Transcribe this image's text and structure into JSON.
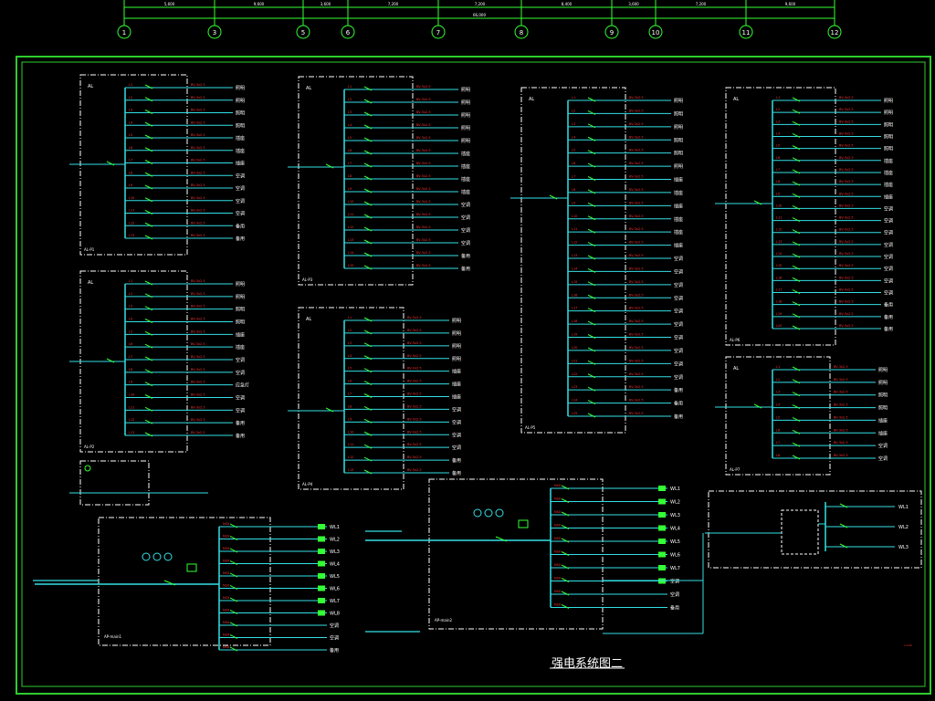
{
  "drawing": {
    "title": "强电系统图二",
    "grid_axes": [
      "1",
      "3",
      "5",
      "6",
      "7",
      "8",
      "9",
      "10",
      "11",
      "12"
    ],
    "dimension_values": [
      "5,600",
      "9,600",
      "3,600",
      "7,200",
      "7,200",
      "8,400",
      "3,600",
      "7,200",
      "9,600"
    ],
    "total_dimension": "66,000"
  },
  "panels": {
    "p1": {
      "feeder_labels": [
        "照明",
        "照明",
        "照明",
        "照明",
        "插座",
        "插座",
        "插座",
        "空调",
        "空调",
        "空调",
        "空调",
        "备用",
        "备用"
      ]
    },
    "p2": {
      "feeder_labels": [
        "照明",
        "照明",
        "照明",
        "照明",
        "插座",
        "插座",
        "空调",
        "空调",
        "应急灯",
        "空调",
        "空调",
        "备用",
        "备用"
      ]
    },
    "p3": {
      "feeder_labels": [
        "照明",
        "照明",
        "照明",
        "照明",
        "照明",
        "插座",
        "插座",
        "插座",
        "插座",
        "空调",
        "空调",
        "空调",
        "空调",
        "备用",
        "备用"
      ]
    },
    "p4": {
      "feeder_labels": [
        "照明",
        "照明",
        "照明",
        "照明",
        "插座",
        "插座",
        "插座",
        "空调",
        "空调",
        "空调",
        "空调",
        "备用",
        "备用"
      ]
    },
    "p5": {
      "feeder_labels": [
        "照明",
        "照明",
        "照明",
        "照明",
        "照明",
        "照明",
        "插座",
        "插座",
        "插座",
        "插座",
        "插座",
        "插座",
        "空调",
        "空调",
        "空调",
        "空调",
        "空调",
        "空调",
        "空调",
        "空调",
        "空调",
        "空调",
        "备用",
        "备用",
        "备用"
      ]
    },
    "p6": {
      "feeder_labels": [
        "照明",
        "照明",
        "照明",
        "照明",
        "照明",
        "插座",
        "插座",
        "插座",
        "插座",
        "空调",
        "空调",
        "空调",
        "空调",
        "空调",
        "空调",
        "空调",
        "空调",
        "备用",
        "备用",
        "备用"
      ]
    },
    "p7": {
      "feeder_labels": [
        "照明",
        "照明",
        "照明",
        "照明",
        "插座",
        "插座",
        "空调",
        "空调"
      ]
    },
    "main1": {
      "feeder_labels": [
        "WL1",
        "WL2",
        "WL3",
        "WL4",
        "WL5",
        "WL6",
        "WL7",
        "WL8",
        "空调",
        "空调",
        "备用"
      ]
    },
    "main2": {
      "feeder_labels": [
        "WL1",
        "WL2",
        "WL3",
        "WL4",
        "WL5",
        "WL6",
        "WL7",
        "空调",
        "空调",
        "备用"
      ]
    },
    "atse": {
      "feeder_labels": [
        "WL1",
        "WL2",
        "WL3"
      ]
    }
  }
}
